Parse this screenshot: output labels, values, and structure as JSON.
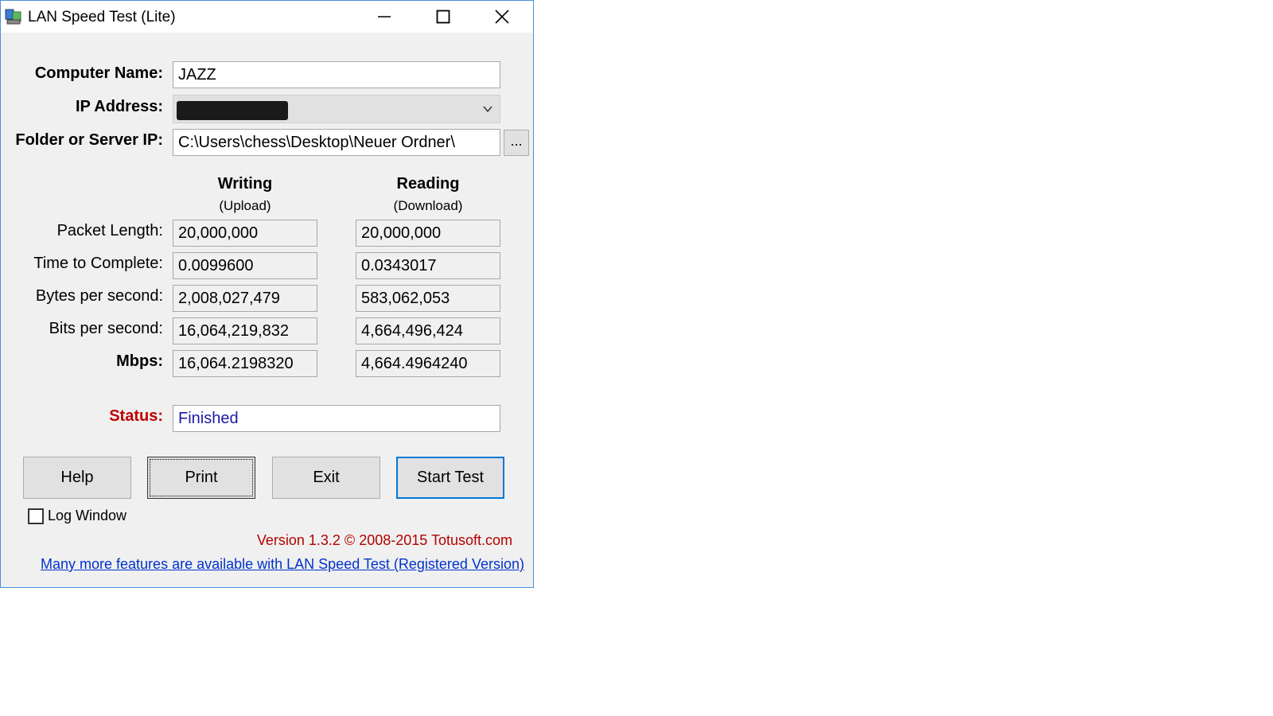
{
  "window": {
    "title": "LAN Speed Test (Lite)",
    "controls": {
      "minimize": "minimize",
      "maximize": "maximize",
      "close": "close"
    }
  },
  "form": {
    "computer_name_label": "Computer Name:",
    "computer_name_value": "JAZZ",
    "ip_label": "IP Address:",
    "folder_label": "Folder or Server IP:",
    "folder_value": "C:\\Users\\chess\\Desktop\\Neuer Ordner\\",
    "browse_label": "..."
  },
  "columns": {
    "writing": {
      "title": "Writing",
      "subtitle": "(Upload)"
    },
    "reading": {
      "title": "Reading",
      "subtitle": "(Download)"
    }
  },
  "rows": [
    {
      "label": "Packet Length:",
      "writing": "20,000,000",
      "reading": "20,000,000"
    },
    {
      "label": "Time to Complete:",
      "writing": "0.0099600",
      "reading": "0.0343017"
    },
    {
      "label": "Bytes per second:",
      "writing": "2,008,027,479",
      "reading": "583,062,053"
    },
    {
      "label": "Bits per second:",
      "writing": "16,064,219,832",
      "reading": "4,664,496,424"
    },
    {
      "label": "Mbps:",
      "writing": "16,064.2198320",
      "reading": "4,664.4964240"
    }
  ],
  "status": {
    "label": "Status:",
    "value": "Finished",
    "label_color": "#c00000",
    "value_color": "#1a1aa6"
  },
  "buttons": {
    "help": "Help",
    "print": "Print",
    "exit": "Exit",
    "start": "Start Test"
  },
  "log_window_label": "Log Window",
  "version_text": "Version 1.3.2 © 2008-2015 Totusoft.com",
  "registered_link": "Many more features are available with LAN Speed Test (Registered Version)"
}
